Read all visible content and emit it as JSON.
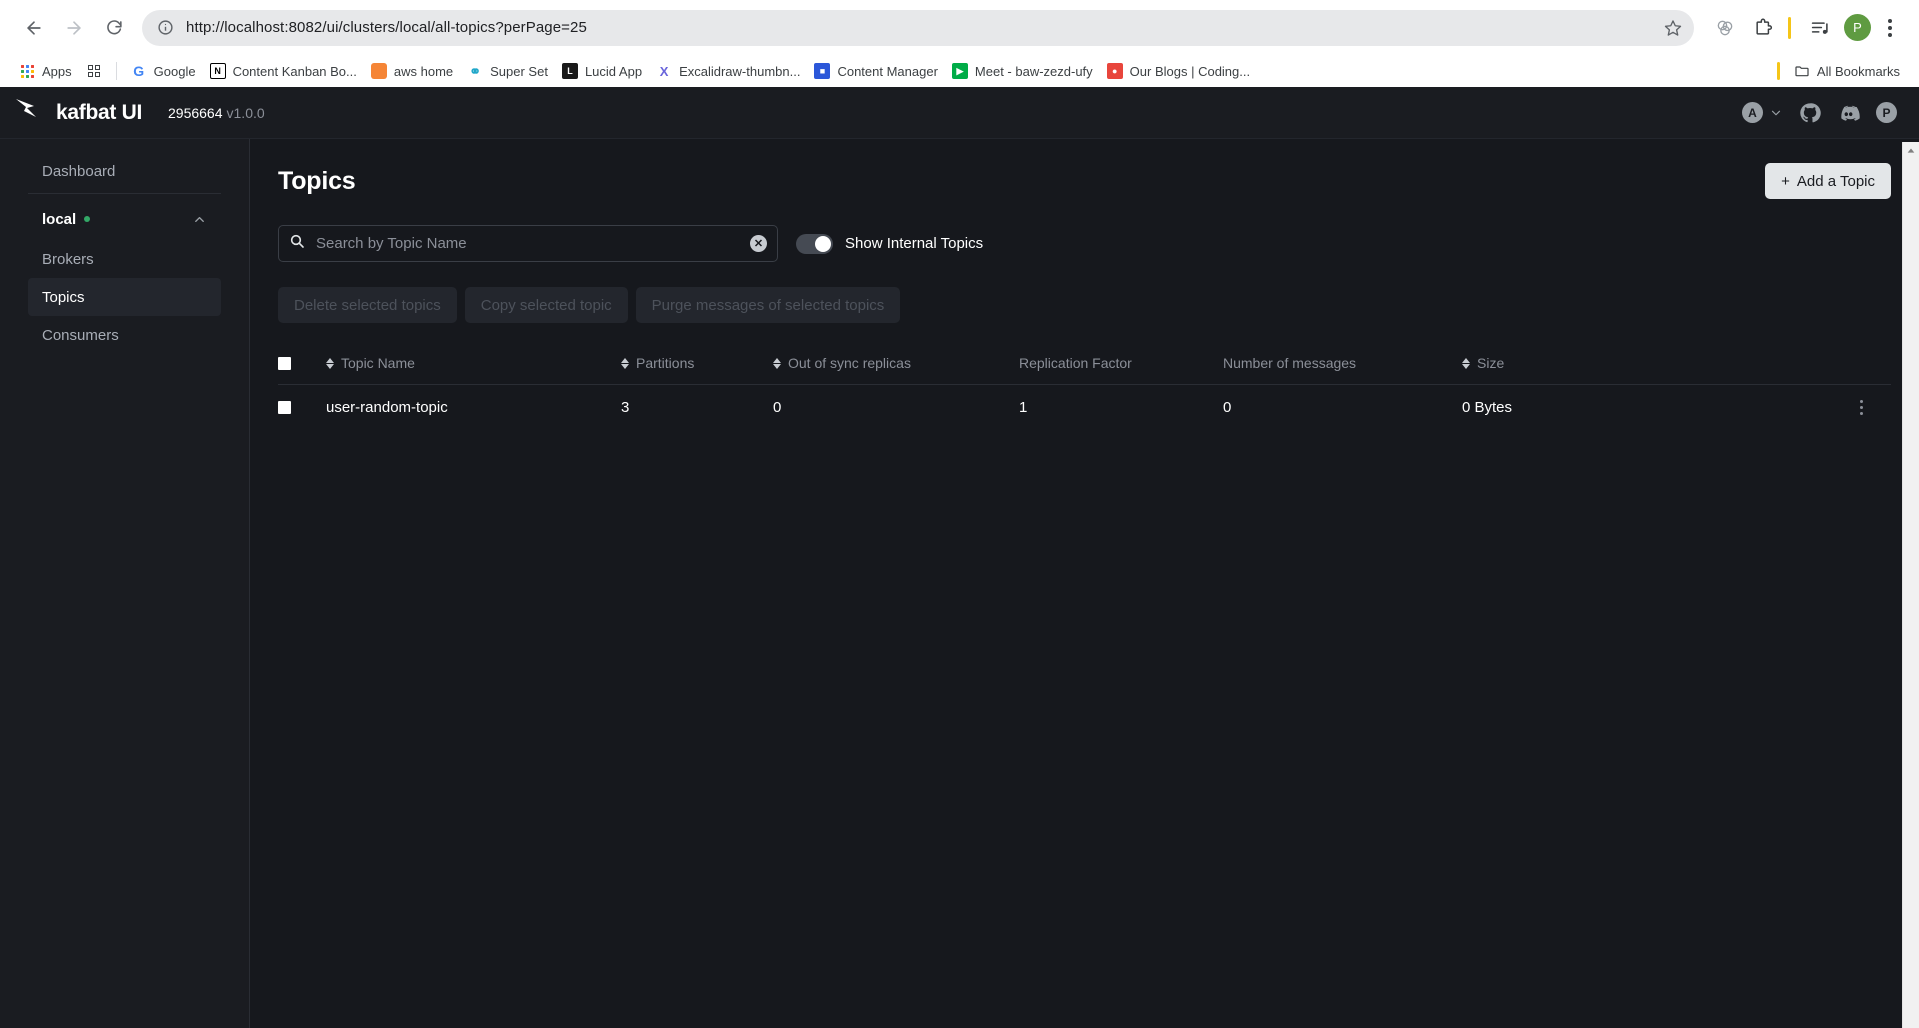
{
  "browser": {
    "url": "http://localhost:8082/ui/clusters/local/all-topics?perPage=25",
    "back_label": "back-icon",
    "forward_label": "forward-icon",
    "reload_label": "reload-icon",
    "profile_initial": "P",
    "bookmarks": [
      {
        "label": "Apps",
        "icon": "apps-grid-icon"
      },
      {
        "label": "Google",
        "icon": "google-icon",
        "color": "#ffffff",
        "glyph": "G"
      },
      {
        "label": "Content Kanban Bo...",
        "icon": "notion-icon",
        "color": "#000000",
        "glyph": "N"
      },
      {
        "label": "aws home",
        "icon": "aws-icon",
        "color": "#f58536",
        "glyph": ""
      },
      {
        "label": "Super Set",
        "icon": "superset-icon",
        "color": "#20a7c9",
        "glyph": ""
      },
      {
        "label": "Lucid App",
        "icon": "lucid-icon",
        "color": "#1a1a1a",
        "glyph": "L"
      },
      {
        "label": "Excalidraw-thumbn...",
        "icon": "excalidraw-icon",
        "color": "#6965db",
        "glyph": "X"
      },
      {
        "label": "Content Manager",
        "icon": "content-manager-icon",
        "color": "#2b57d9",
        "glyph": ""
      },
      {
        "label": "Meet - baw-zezd-ufy",
        "icon": "google-meet-icon",
        "color": "#00ac47",
        "glyph": ""
      },
      {
        "label": "Our Blogs | Coding...",
        "icon": "blogs-icon",
        "color": "#e8453c",
        "glyph": ""
      }
    ],
    "all_bookmarks_label": "All Bookmarks"
  },
  "app_header": {
    "brand": "kafbat UI",
    "build": "2956664",
    "version": "v1.0.0",
    "account_initial": "A",
    "profile_initial": "P"
  },
  "sidebar": {
    "dashboard_label": "Dashboard",
    "cluster": {
      "name": "local",
      "status": "online"
    },
    "items": [
      {
        "label": "Brokers",
        "active": false
      },
      {
        "label": "Topics",
        "active": true
      },
      {
        "label": "Consumers",
        "active": false
      }
    ]
  },
  "main": {
    "title": "Topics",
    "add_topic_label": "+ Add a Topic",
    "add_topic_plus": "+",
    "add_topic_text": "Add a Topic",
    "search": {
      "value": "",
      "placeholder": "Search by Topic Name"
    },
    "toggle": {
      "label": "Show Internal Topics",
      "on": true
    },
    "actions": [
      "Delete selected topics",
      "Copy selected topic",
      "Purge messages of selected topics"
    ],
    "table": {
      "columns": [
        {
          "label": "Topic Name",
          "sortable": true
        },
        {
          "label": "Partitions",
          "sortable": true
        },
        {
          "label": "Out of sync replicas",
          "sortable": true
        },
        {
          "label": "Replication Factor",
          "sortable": false
        },
        {
          "label": "Number of messages",
          "sortable": false
        },
        {
          "label": "Size",
          "sortable": true
        }
      ],
      "rows": [
        {
          "name": "user-random-topic",
          "partitions": "3",
          "out_of_sync_replicas": "0",
          "replication_factor": "1",
          "number_of_messages": "0",
          "size": "0 Bytes"
        }
      ]
    }
  },
  "colors": {
    "app_bg": "#16181d",
    "panel_bg": "#1a1c21",
    "accent_green": "#33a867",
    "button_light": "#e3e6e8",
    "muted_text": "#8b8f98"
  }
}
